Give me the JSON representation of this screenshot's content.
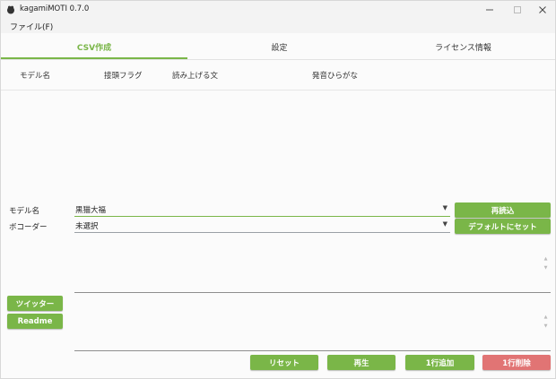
{
  "window": {
    "title": "kagamiMOTI 0.7.0"
  },
  "menu": {
    "file": "ファイル(F)"
  },
  "tabs": [
    {
      "label": "CSV作成",
      "active": true
    },
    {
      "label": "設定",
      "active": false
    },
    {
      "label": "ライセンス情報",
      "active": false
    }
  ],
  "table": {
    "columns": [
      "モデル名",
      "接頭フラグ",
      "読み上げる文",
      "発音ひらがな"
    ]
  },
  "form": {
    "model_label": "モデル名",
    "model_value": "黒猫大福",
    "vocoder_label": "ボコーダー",
    "vocoder_value": "未選択"
  },
  "buttons": {
    "reload": "再読込",
    "set_default": "デフォルトにセット",
    "twitter": "ツイッター",
    "readme": "Readme",
    "reset": "リセット",
    "play": "再生",
    "add_row": "1行追加",
    "delete_row": "1行削除"
  },
  "colors": {
    "accent_green": "#7ab648",
    "danger_red": "#e17474"
  }
}
